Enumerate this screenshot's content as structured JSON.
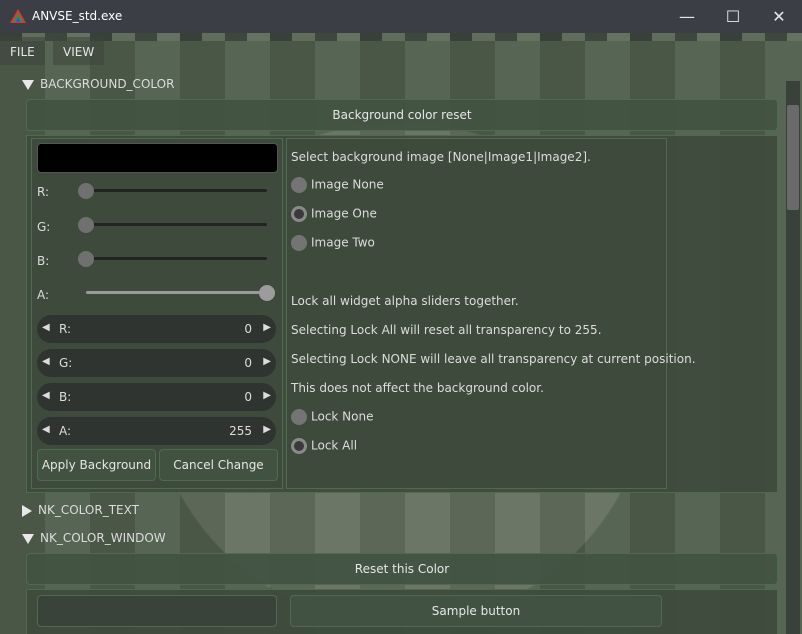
{
  "window": {
    "title": "ANVSE_std.exe",
    "minimize": "—",
    "maximize": "☐",
    "close": "✕"
  },
  "menu": {
    "file": "FILE",
    "view": "VIEW"
  },
  "tree": {
    "background_color": "BACKGROUND_COLOR",
    "nk_color_text": "NK_COLOR_TEXT",
    "nk_color_window": "NK_COLOR_WINDOW"
  },
  "buttons": {
    "bg_reset": "Background color reset",
    "apply": "Apply Background",
    "cancel": "Cancel Change",
    "reset_color": "Reset this Color",
    "sample": "Sample button"
  },
  "color_preview": "#000000",
  "sliders": {
    "r_label": "R:",
    "g_label": "G:",
    "b_label": "B:",
    "a_label": "A:",
    "r": 0,
    "g": 0,
    "b": 0,
    "a": 255
  },
  "properties": [
    {
      "label": "R:",
      "value": "0"
    },
    {
      "label": "G:",
      "value": "0"
    },
    {
      "label": "B:",
      "value": "0"
    },
    {
      "label": "A:",
      "value": "255"
    }
  ],
  "image_section": {
    "heading": "Select background image [None|Image1|Image2].",
    "options": [
      "Image None",
      "Image One",
      "Image Two"
    ],
    "selected": "Image One"
  },
  "lock_section": {
    "line1": "Lock all widget alpha sliders together.",
    "line2": "Selecting Lock All will reset all transparency to 255.",
    "line3": "Selecting Lock NONE will leave all transparency at current position.",
    "line4": "This does not affect the background color.",
    "options": [
      "Lock None",
      "Lock All"
    ],
    "selected": "Lock All"
  },
  "icons": {
    "expanded": "triangle-down-icon",
    "collapsed": "triangle-right-icon",
    "left_arrow": "◀",
    "right_arrow": "▶"
  }
}
